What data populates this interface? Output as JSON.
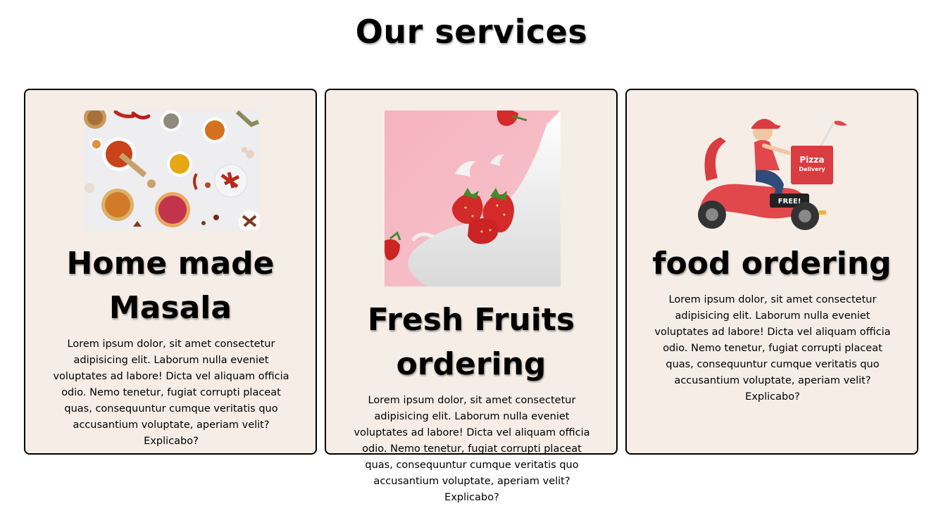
{
  "page": {
    "title": "Our services"
  },
  "services": [
    {
      "title": "Home made Masala",
      "text": "Lorem ipsum dolor, sit amet consectetur adipisicing elit. Laborum nulla eveniet voluptates ad labore! Dicta vel aliquam officia odio. Nemo tenetur, fugiat corrupti placeat quas, consequuntur cumque veritatis quo accusantium voluptate, aperiam velit? Explicabo?",
      "image": "spices-bowls-image"
    },
    {
      "title": "Fresh Fruits ordering",
      "text": "Lorem ipsum dolor, sit amet consectetur adipisicing elit. Laborum nulla eveniet voluptates ad labore! Dicta vel aliquam officia odio. Nemo tenetur, fugiat corrupti placeat quas, consequuntur cumque veritatis quo accusantium voluptate, aperiam velit? Explicabo?",
      "image": "strawberries-milk-splash-image"
    },
    {
      "title": "food ordering",
      "text": "Lorem ipsum dolor, sit amet consectetur adipisicing elit. Laborum nulla eveniet voluptates ad labore! Dicta vel aliquam officia odio. Nemo tenetur, fugiat corrupti placeat quas, consequuntur cumque veritatis quo accusantium voluptate, aperiam velit? Explicabo?",
      "image": "pizza-delivery-scooter-image",
      "illustration_text": {
        "box_line1": "Pizza",
        "box_line2": "Delivery",
        "scooter_badge": "FREE!"
      }
    }
  ],
  "colors": {
    "card_background": "#f5ede6",
    "card_border": "#000000",
    "page_background": "#ffffff"
  }
}
